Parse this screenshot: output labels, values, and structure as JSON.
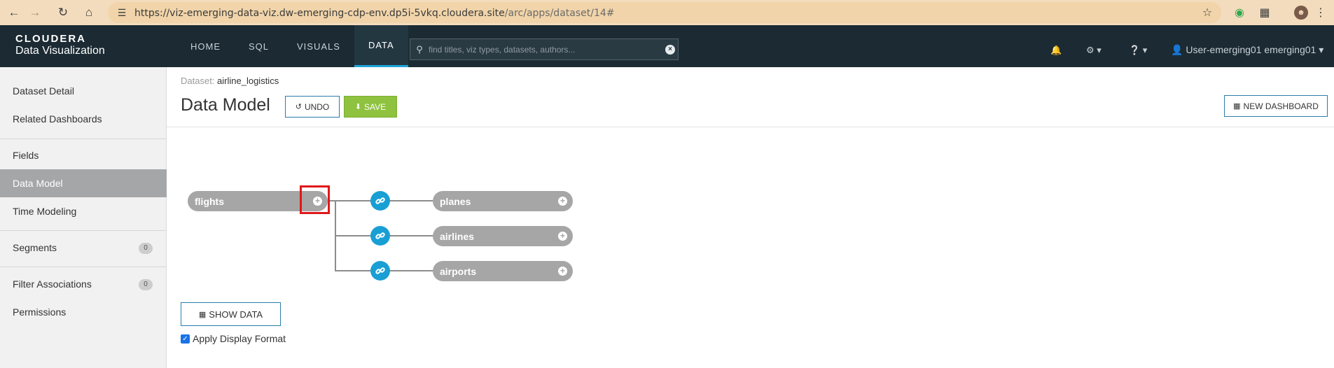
{
  "browser": {
    "url_host": "https://viz-emerging-data-viz.dw-emerging-cdp-env.dp5i-5vkq.cloudera.site",
    "url_path": "/arc/apps/dataset/14#"
  },
  "brand": {
    "line1": "CLOUDERA",
    "line2": "Data Visualization"
  },
  "topnav": [
    {
      "label": "HOME"
    },
    {
      "label": "SQL"
    },
    {
      "label": "VISUALS"
    },
    {
      "label": "DATA",
      "active": true
    }
  ],
  "search": {
    "placeholder": "find titles, viz types, datasets, authors..."
  },
  "user": {
    "label": "User-emerging01 emerging01"
  },
  "sidebar": {
    "items": [
      {
        "label": "Dataset Detail"
      },
      {
        "label": "Related Dashboards"
      },
      {
        "label": "Fields"
      },
      {
        "label": "Data Model",
        "active": true
      },
      {
        "label": "Time Modeling"
      },
      {
        "label": "Segments",
        "count": "0"
      },
      {
        "label": "Filter Associations",
        "count": "0"
      },
      {
        "label": "Permissions"
      }
    ]
  },
  "breadcrumb": {
    "label": "Dataset:",
    "value": "airline_logistics"
  },
  "page": {
    "title": "Data Model"
  },
  "toolbar": {
    "undo_label": "UNDO",
    "save_label": "SAVE",
    "new_dashboard_label": "NEW DASHBOARD"
  },
  "model": {
    "primary": "flights",
    "joined": [
      "planes",
      "airlines",
      "airports"
    ]
  },
  "show_data_label": "SHOW DATA",
  "apply_format_label": "Apply Display Format",
  "colors": {
    "accent": "#189fd4",
    "save": "#8ec23f",
    "header": "#1b2a33",
    "node": "#a6a6a6",
    "highlight": "#e0181b"
  }
}
